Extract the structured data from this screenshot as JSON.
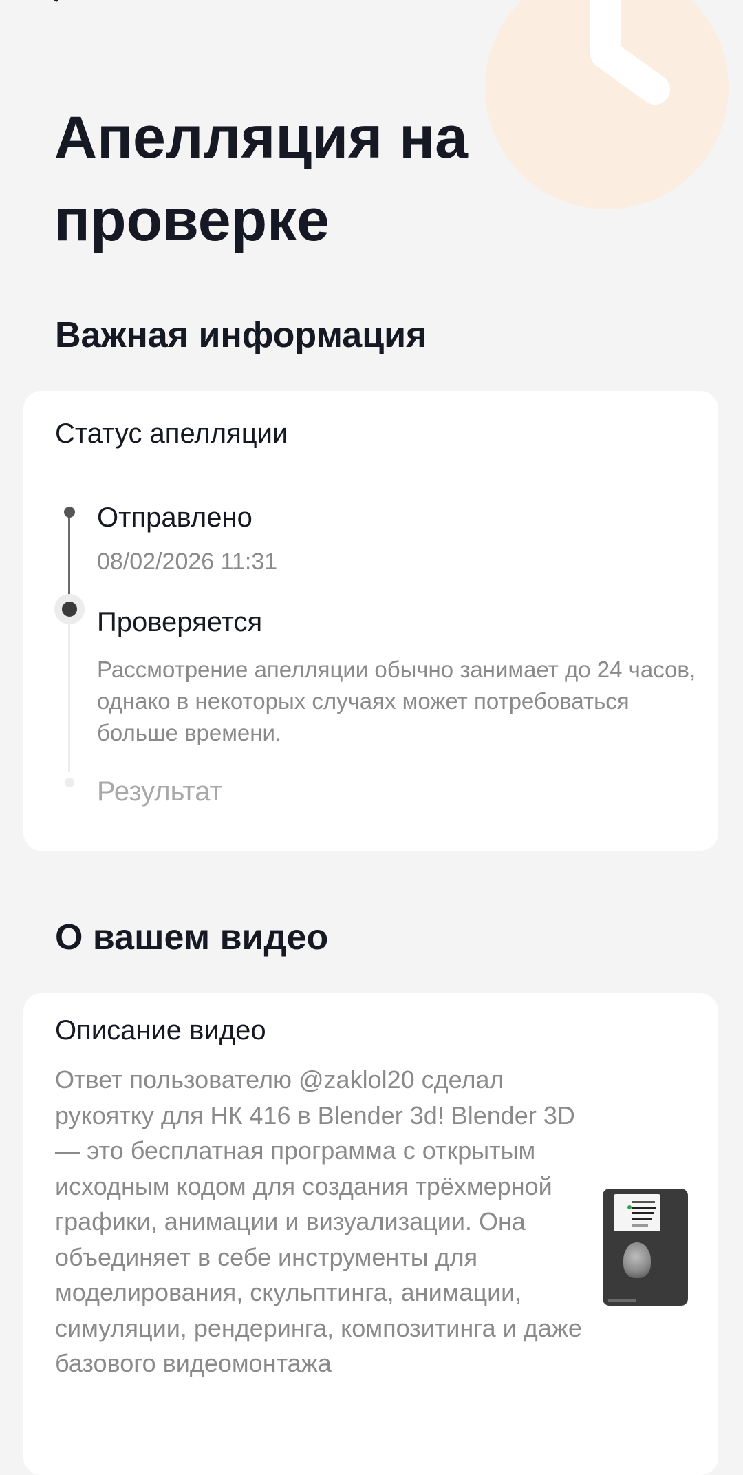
{
  "header": {
    "title": "Апелляция на проверке",
    "back_icon": "back-arrow-icon",
    "decor_icon": "clock-icon"
  },
  "important": {
    "title": "Важная информация",
    "card_title": "Статус апелляции",
    "steps": [
      {
        "label": "Отправлено",
        "date": "08/02/2026 11:31"
      },
      {
        "label": "Проверяется",
        "description": "Рассмотрение апелляции обычно занимает до 24 часов, однако в некоторых случаях может потребоваться больше времени."
      },
      {
        "label": "Результат"
      }
    ]
  },
  "video": {
    "title": "О вашем видео",
    "card_title": "Описание видео",
    "description": "Ответ пользователю @zaklol20 сделал рукоятку для НК 416 в Blender 3d! Blender 3D — это бесплатная программа с открытым исходным кодом для создания трёхмерной графики, анимации и визуализации. Она объединяет в себе инструменты для моделирования, скульптинга, анимации, симуляции, рендеринга, композитинга и даже базового видеомонтажа"
  },
  "colors": {
    "background": "#f4f4f4",
    "card": "#ffffff",
    "text_primary": "#161823",
    "text_secondary": "#8a8a8a",
    "text_disabled": "#a8a8a8",
    "decor_accent": "#fcebd9"
  }
}
